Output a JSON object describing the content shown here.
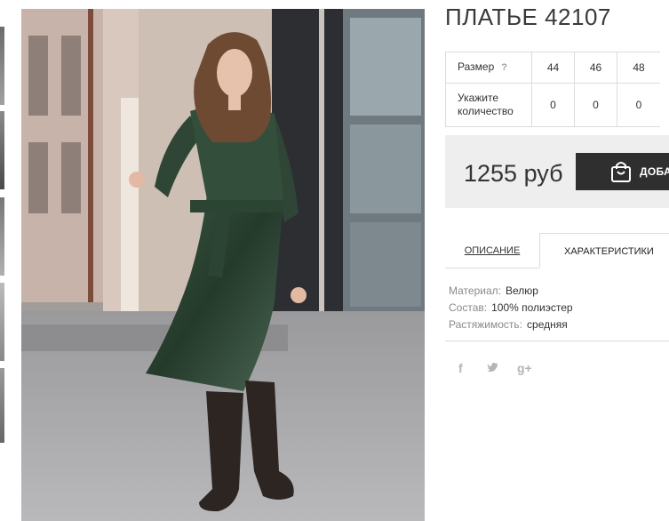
{
  "product": {
    "title": "ПЛАТЬЕ 42107"
  },
  "sizes_table": {
    "size_label": "Размер",
    "help": "?",
    "sizes": [
      "44",
      "46",
      "48"
    ],
    "qty_label": "Укажите количество",
    "quantities": [
      "0",
      "0",
      "0"
    ]
  },
  "price": {
    "value": "1255 руб",
    "add_button": "ДОБА"
  },
  "tabs": {
    "description": "ОПИСАНИЕ",
    "characteristics": "ХАРАКТЕРИСТИКИ"
  },
  "specs": [
    {
      "key": "Материал:",
      "value": "Велюр"
    },
    {
      "key": "Состав:",
      "value": "100% полиэстер"
    },
    {
      "key": "Растяжимость:",
      "value": "средняя"
    }
  ],
  "social": {
    "facebook": "f",
    "twitter": "t",
    "google": "g+"
  },
  "icons": [
    "shopping-bag-icon",
    "facebook-icon",
    "twitter-icon",
    "google-plus-icon"
  ],
  "colors": {
    "button_bg": "#2f2f2f",
    "price_bg": "#eeeeee",
    "border": "#dcdcdc"
  }
}
